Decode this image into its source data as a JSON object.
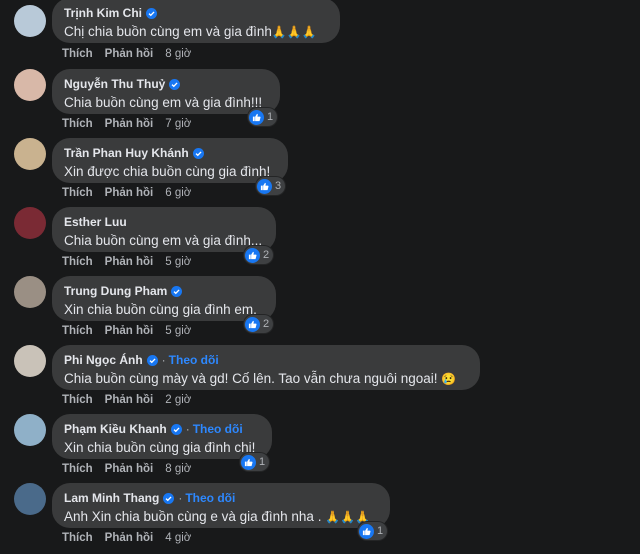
{
  "actions": {
    "like": "Thích",
    "reply": "Phản hồi",
    "follow": "Theo dõi"
  },
  "comments": [
    {
      "name": "Trịnh Kim Chi",
      "verified": true,
      "follow": false,
      "text": "Chị chia buồn cùng em và gia đình",
      "emoji": "🙏🙏🙏",
      "time": "8 giờ",
      "reactions": "",
      "avatar_color": "#b8c9d8"
    },
    {
      "name": "Nguyễn Thu Thuỷ",
      "verified": true,
      "follow": false,
      "text": "Chia buồn cùng em và gia đình!!!",
      "emoji": "",
      "time": "7 giờ",
      "reactions": "1",
      "avatar_color": "#d8b8a8"
    },
    {
      "name": "Trần Phan Huy Khánh",
      "verified": true,
      "follow": false,
      "text": "Xin được chia buồn cùng gia đình!",
      "emoji": "",
      "time": "6 giờ",
      "reactions": "3",
      "avatar_color": "#c9b28f"
    },
    {
      "name": "Esther Luu",
      "verified": false,
      "follow": false,
      "text": "Chia buồn cùng em và gia đình...",
      "emoji": "",
      "time": "5 giờ",
      "reactions": "2",
      "avatar_color": "#7a2a34"
    },
    {
      "name": "Trung Dung Pham",
      "verified": true,
      "follow": false,
      "text": "Xin chia buồn cùng gia đình em.",
      "emoji": "",
      "time": "5 giờ",
      "reactions": "2",
      "avatar_color": "#9a8f84"
    },
    {
      "name": "Phi Ngọc Ánh",
      "verified": true,
      "follow": true,
      "text": "Chia buồn cùng mày và gd! Cố lên. Tao vẫn chưa nguôi ngoai!",
      "emoji": "😢",
      "time": "2 giờ",
      "reactions": "",
      "avatar_color": "#c9c2b8"
    },
    {
      "name": "Phạm Kiều Khanh",
      "verified": true,
      "follow": true,
      "text": "Xin chia buồn cùng gia đình chị!",
      "emoji": "",
      "time": "8 giờ",
      "reactions": "1",
      "avatar_color": "#8fb0c8"
    },
    {
      "name": "Lam Minh Thang",
      "verified": true,
      "follow": true,
      "text": "Anh Xin chia buồn cùng e và gia đình nha .",
      "emoji": "🙏🙏🙏",
      "time": "4 giờ",
      "reactions": "1",
      "avatar_color": "#4a6a8a"
    }
  ]
}
